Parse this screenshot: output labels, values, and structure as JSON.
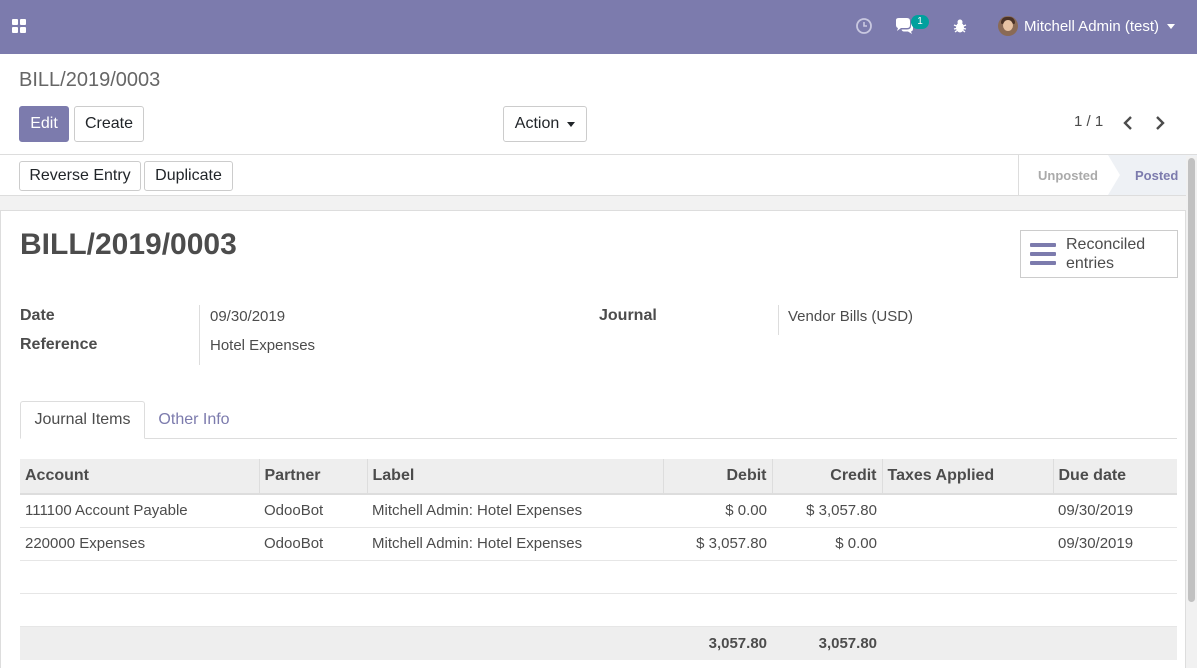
{
  "navbar": {
    "user_name": "Mitchell Admin (test)",
    "messages_count": "1",
    "accent_color": "#7c7bad"
  },
  "breadcrumb": "BILL/2019/0003",
  "buttons": {
    "edit": "Edit",
    "create": "Create",
    "action": "Action",
    "reverse_entry": "Reverse Entry",
    "duplicate": "Duplicate"
  },
  "pager": "1 / 1",
  "status": {
    "stages": [
      "Unposted",
      "Posted"
    ],
    "current": "Posted"
  },
  "record": {
    "title": "BILL/2019/0003",
    "smart_button": "Reconciled entries",
    "fields": {
      "date_label": "Date",
      "date_value": "09/30/2019",
      "reference_label": "Reference",
      "reference_value": "Hotel Expenses",
      "journal_label": "Journal",
      "journal_value": "Vendor Bills (USD)"
    }
  },
  "tabs": [
    "Journal Items",
    "Other Info"
  ],
  "table": {
    "headers": [
      "Account",
      "Partner",
      "Label",
      "Debit",
      "Credit",
      "Taxes Applied",
      "Due date"
    ],
    "rows": [
      [
        "111100 Account Payable",
        "OdooBot",
        "Mitchell Admin: Hotel Expenses",
        "$ 0.00",
        "$ 3,057.80",
        "",
        "09/30/2019"
      ],
      [
        "220000 Expenses",
        "OdooBot",
        "Mitchell Admin: Hotel Expenses",
        "$ 3,057.80",
        "$ 0.00",
        "",
        "09/30/2019"
      ]
    ],
    "totals": {
      "debit": "3,057.80",
      "credit": "3,057.80"
    }
  }
}
